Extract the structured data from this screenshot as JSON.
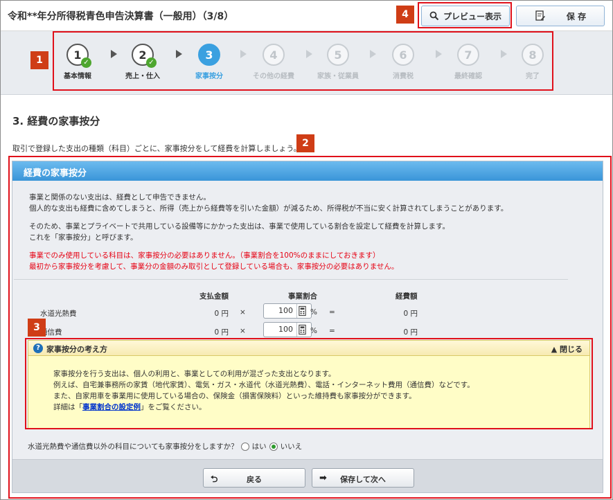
{
  "header": {
    "title": "令和**年分所得税青色申告決算書（一般用）（3/8）",
    "preview_label": "プレビュー表示",
    "save_label": "保 存"
  },
  "annotations": [
    "1",
    "2",
    "3",
    "4"
  ],
  "steps": [
    {
      "num": "1",
      "label": "基本情報",
      "state": "done"
    },
    {
      "num": "2",
      "label": "売上・仕入",
      "state": "done"
    },
    {
      "num": "3",
      "label": "家事按分",
      "state": "active"
    },
    {
      "num": "4",
      "label": "その他の経費",
      "state": "pending"
    },
    {
      "num": "5",
      "label": "家族・従業員",
      "state": "pending"
    },
    {
      "num": "6",
      "label": "消費税",
      "state": "pending"
    },
    {
      "num": "7",
      "label": "最終確認",
      "state": "pending"
    },
    {
      "num": "8",
      "label": "完了",
      "state": "pending"
    }
  ],
  "section_title": "3.  経費の家事按分",
  "intro": "取引で登録した支出の種類（科目）ごとに、家事按分をして経費を計算しましょう。",
  "panel": {
    "title": "経費の家事按分",
    "para1": [
      "事業と関係のない支出は、経費として申告できません。",
      "個人的な支出も経費に含めてしまうと、所得（売上から経費等を引いた金額）が減るため、所得税が不当に安く計算されてしまうことがあります。"
    ],
    "para2": [
      "そのため、事業とプライベートで共用している設備等にかかった支出は、事業で使用している割合を設定して経費を計算します。",
      "これを「家事按分」と呼びます。"
    ],
    "para3": [
      "事業でのみ使用している科目は、家事按分の必要はありません。（事業割合を100%のままにしておきます）",
      "最初から家事按分を考慮して、事業分の金額のみ取引として登録している場合も、家事按分の必要はありません。"
    ],
    "columns": {
      "amount": "支払金額",
      "ratio": "事業割合",
      "expense": "経費額"
    },
    "rows": [
      {
        "label": "水道光熱費",
        "amount": "0 円",
        "times": "×",
        "ratio": "100",
        "pct": "%",
        "eq": "=",
        "expense": "0 円"
      },
      {
        "label": "通信費",
        "amount": "0 円",
        "times": "×",
        "ratio": "100",
        "pct": "%",
        "eq": "=",
        "expense": "0 円"
      }
    ],
    "hint": {
      "title": "家事按分の考え方",
      "close_label": "▲ 閉じる",
      "lines": [
        "家事按分を行う支出は、個人の利用と、事業としての利用が混ざった支出となります。",
        "例えば、自宅兼事務所の家賃（地代家賃）、電気・ガス・水道代（水道光熱費）、電話・インターネット費用（通信費）などです。",
        "また、自家用車を事業用に使用している場合の、保険金（損害保険料）といった維持費も家事按分ができます。"
      ],
      "detail_prefix": "詳細は「",
      "detail_link": "事業割合の設定例",
      "detail_suffix": "」をご覧ください。"
    },
    "question": "水道光熱費や通信費以外の科目についても家事按分をしますか？",
    "yes_label": "はい",
    "no_label": "いいえ",
    "back_label": "戻る",
    "next_label": "保存して次へ"
  }
}
